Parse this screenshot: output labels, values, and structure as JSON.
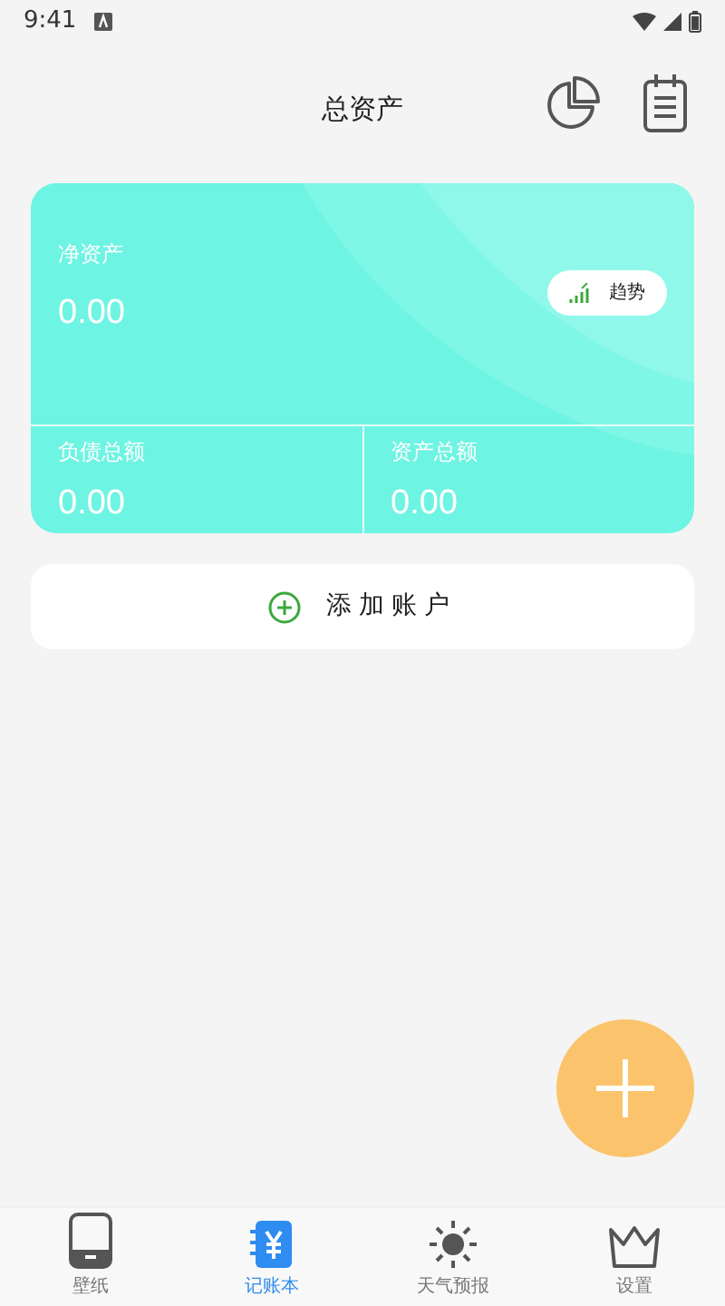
{
  "status_bar": {
    "time": "9:41"
  },
  "header": {
    "title": "总资产"
  },
  "summary_card": {
    "net_assets": {
      "label": "净资产",
      "value": "0.00"
    },
    "trend_button": {
      "label": "趋势"
    },
    "totals": [
      {
        "label": "负债总额",
        "value": "0.00"
      },
      {
        "label": "资产总额",
        "value": "0.00"
      }
    ]
  },
  "add_account_button": {
    "label": "添加账户"
  },
  "bottom_nav": [
    {
      "kind": "tablet",
      "label": "壁纸",
      "selected": false
    },
    {
      "kind": "ledger",
      "label": "记账本",
      "selected": true
    },
    {
      "kind": "weather",
      "label": "天气预报",
      "selected": false
    },
    {
      "kind": "crown",
      "label": "设置",
      "selected": false
    }
  ]
}
